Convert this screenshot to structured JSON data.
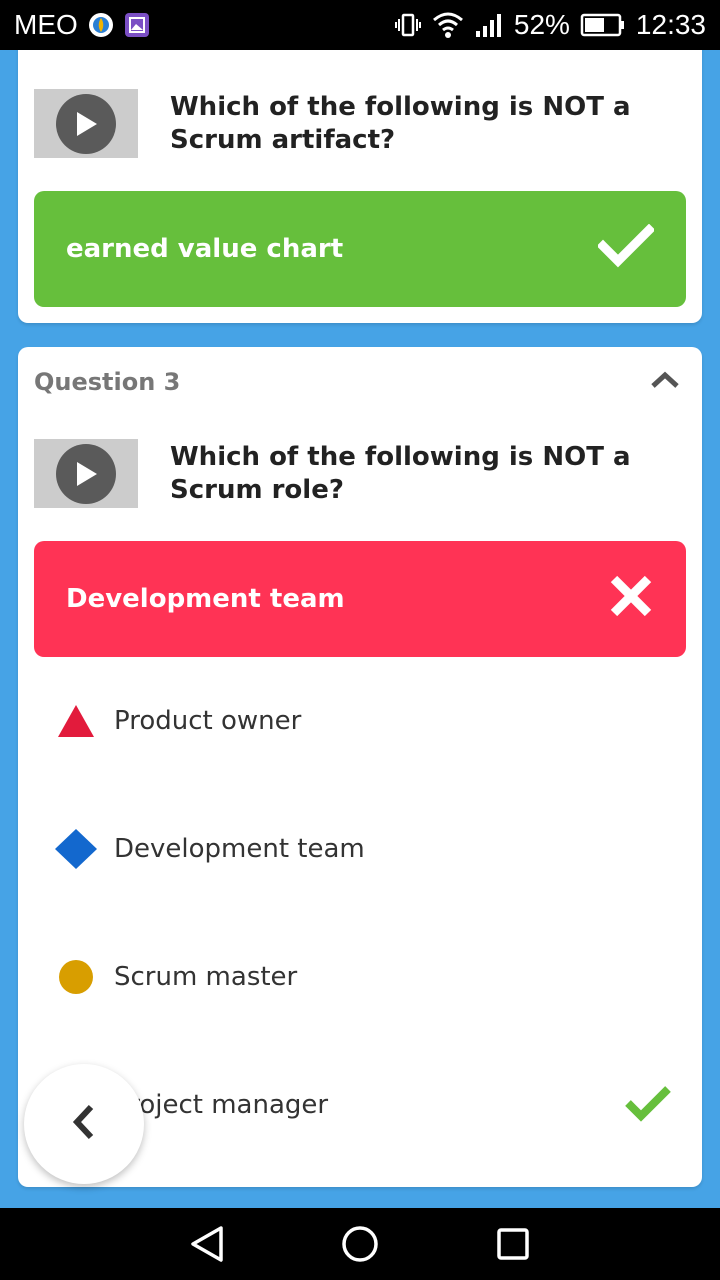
{
  "status_bar": {
    "carrier": "MEO",
    "battery": "52%",
    "time": "12:33"
  },
  "card1": {
    "question": "Which of the following is NOT a Scrum artifact?",
    "answer": "earned value chart",
    "answer_status": "correct"
  },
  "card2": {
    "title": "Question 3",
    "question": "Which of the following is NOT a Scrum role?",
    "answer": "Development team",
    "answer_status": "wrong",
    "options": [
      {
        "label": "Product owner",
        "shape": "triangle-icon",
        "color": "#e21b3c"
      },
      {
        "label": "Development team",
        "shape": "diamond-icon",
        "color": "#1368ce"
      },
      {
        "label": "Scrum master",
        "shape": "circle-icon",
        "color": "#d89e00"
      },
      {
        "label": "Project manager",
        "shape": "square-icon",
        "color": "#26890c",
        "correct": true
      }
    ]
  },
  "colors": {
    "background": "#46a3e6",
    "correct": "#66bf3c",
    "wrong": "#ff3355"
  }
}
